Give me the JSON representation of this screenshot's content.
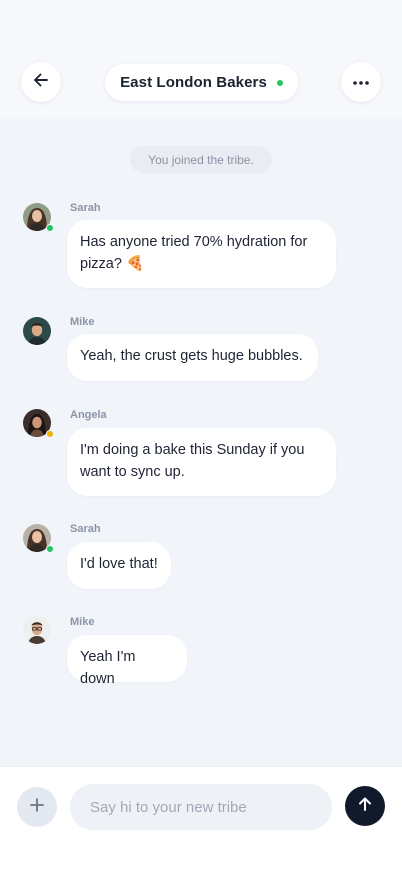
{
  "header": {
    "back_icon": "arrow-left-icon",
    "title": "East London Bakers",
    "status_color": "#22c55e",
    "more_icon": "more-horizontal-icon"
  },
  "system_message": "You joined the tribe.",
  "messages": [
    {
      "sender": "Sarah",
      "text": "Has anyone tried 70% hydration for pizza? 🍕",
      "presence": "online"
    },
    {
      "sender": "Mike",
      "text": "Yeah, the crust gets huge bubbles.",
      "presence": "none"
    },
    {
      "sender": "Angela",
      "text": "I'm doing a bake this Sunday if you want to sync up.",
      "presence": "away"
    },
    {
      "sender": "Sarah",
      "text": "I'd love that!",
      "presence": "online"
    },
    {
      "sender": "Mike",
      "text": "Yeah I'm down",
      "presence": "none"
    }
  ],
  "composer": {
    "add_icon": "plus-icon",
    "placeholder": "Say hi to your new tribe",
    "value": "",
    "send_icon": "arrow-up-icon"
  },
  "colors": {
    "online": "#22c55e",
    "away": "#eab308",
    "send_button": "#111a2b"
  }
}
